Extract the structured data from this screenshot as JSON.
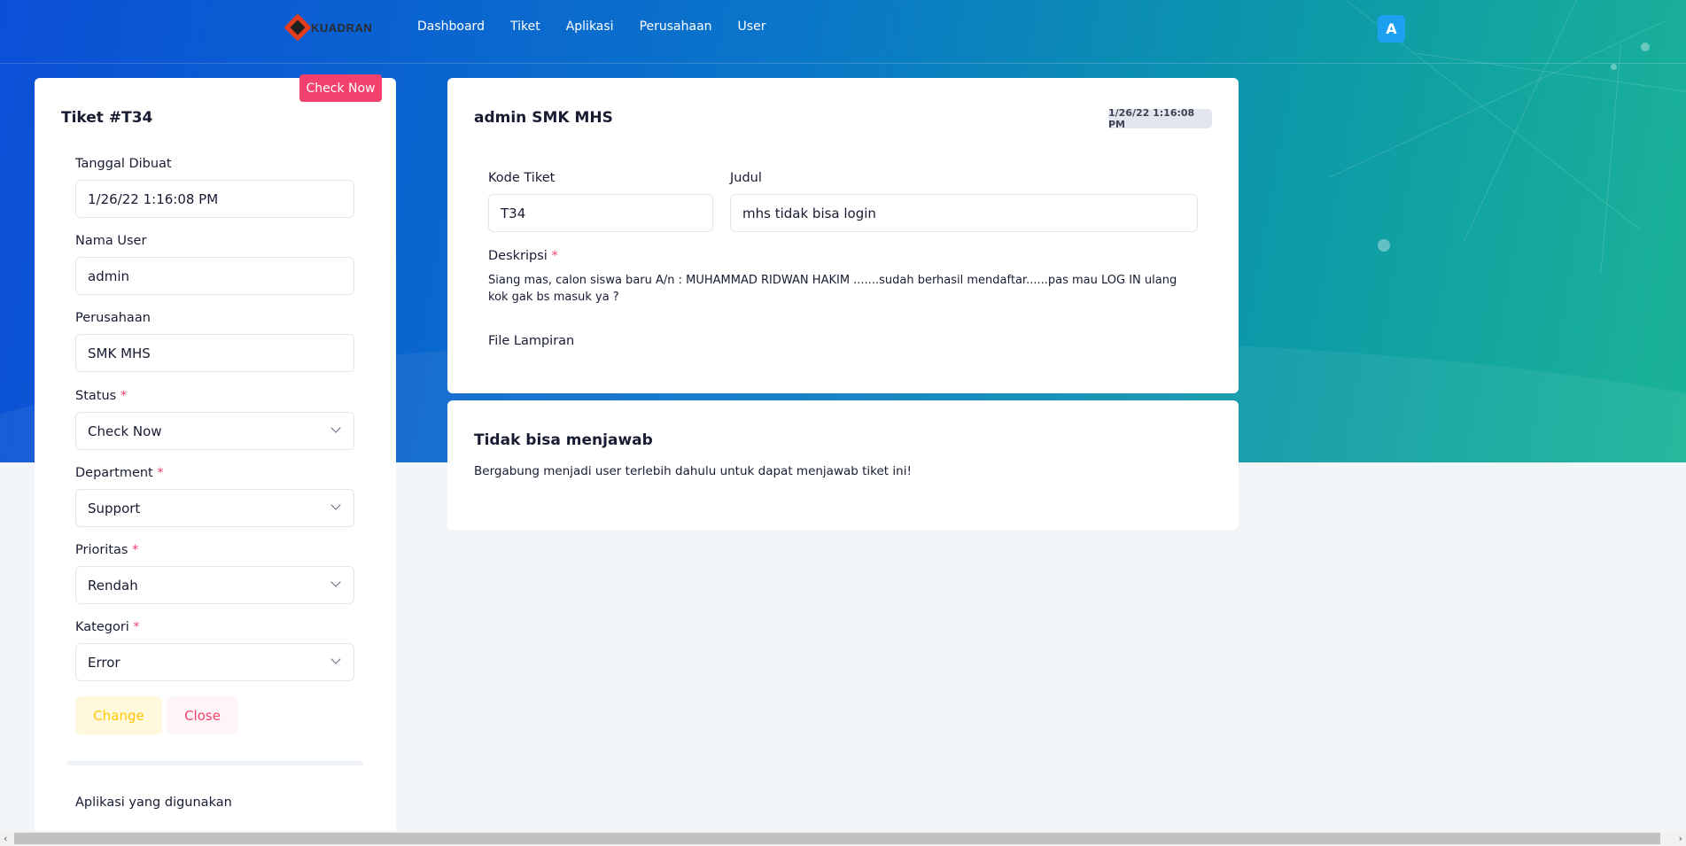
{
  "nav": {
    "logo_text": "KUADRAN",
    "links": [
      "Dashboard",
      "Tiket",
      "Aplikasi",
      "Perusahaan",
      "User"
    ],
    "avatar": "A"
  },
  "ticket_form": {
    "ribbon": "Check Now",
    "title": "Tiket #T34",
    "created_label": "Tanggal Dibuat",
    "created_value": "1/26/22 1:16:08 PM",
    "user_label": "Nama User",
    "user_value": "admin",
    "company_label": "Perusahaan",
    "company_value": "SMK MHS",
    "status_label": "Status",
    "status_value": "Check Now",
    "department_label": "Department",
    "department_value": "Support",
    "priority_label": "Prioritas",
    "priority_value": "Rendah",
    "category_label": "Kategori",
    "category_value": "Error",
    "required_mark": "*",
    "change_label": "Change",
    "close_label": "Close",
    "apps_heading": "Aplikasi yang digunakan"
  },
  "ticket_detail": {
    "title": "admin SMK MHS",
    "timestamp": "1/26/22 1:16:08 PM",
    "code_label": "Kode Tiket",
    "code_value": "T34",
    "subject_label": "Judul",
    "subject_value": "mhs tidak bisa login",
    "description_label": "Deskripsi",
    "description_text": "Siang mas, calon siswa baru A/n : MUHAMMAD RIDWAN HAKIM .......sudah berhasil mendaftar......pas mau LOG IN ulang kok gak bs masuk ya ?",
    "attachment_label": "File Lampiran"
  },
  "reply": {
    "title": "Tidak bisa menjawab",
    "message": "Bergabung menjadi user terlebih dahulu untuk dapat menjawab tiket ini!"
  },
  "scroll": {
    "left_arrow": "‹",
    "right_arrow": "›"
  }
}
